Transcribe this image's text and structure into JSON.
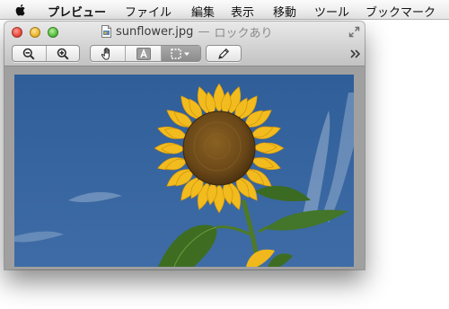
{
  "menubar": {
    "apple_icon": "apple-logo-icon",
    "app_name": "プレビュー",
    "items": [
      "ファイル",
      "編集",
      "表示",
      "移動",
      "ツール",
      "ブックマーク"
    ]
  },
  "window": {
    "filename": "sunflower.jpg",
    "separator": "—",
    "lock_status": "ロックあり",
    "document_icon": "image-document-icon",
    "fullscreen_icon": "fullscreen-arrows-icon",
    "toolbar": {
      "zoom_group": [
        "zoom-out-icon",
        "zoom-in-icon"
      ],
      "tool_group": [
        "hand-tool-icon",
        "text-tool-icon",
        "selection-tool-icon"
      ],
      "selected_tool": "selection-tool-icon",
      "annotate": "pencil-icon",
      "overflow": "chevron-double-right-icon"
    }
  },
  "image": {
    "subject": "sunflower",
    "sky_color": "#3c6aa3",
    "petal_color": "#f0b81c",
    "center_color": "#6b4a1a",
    "leaf_color": "#3e6d22"
  }
}
